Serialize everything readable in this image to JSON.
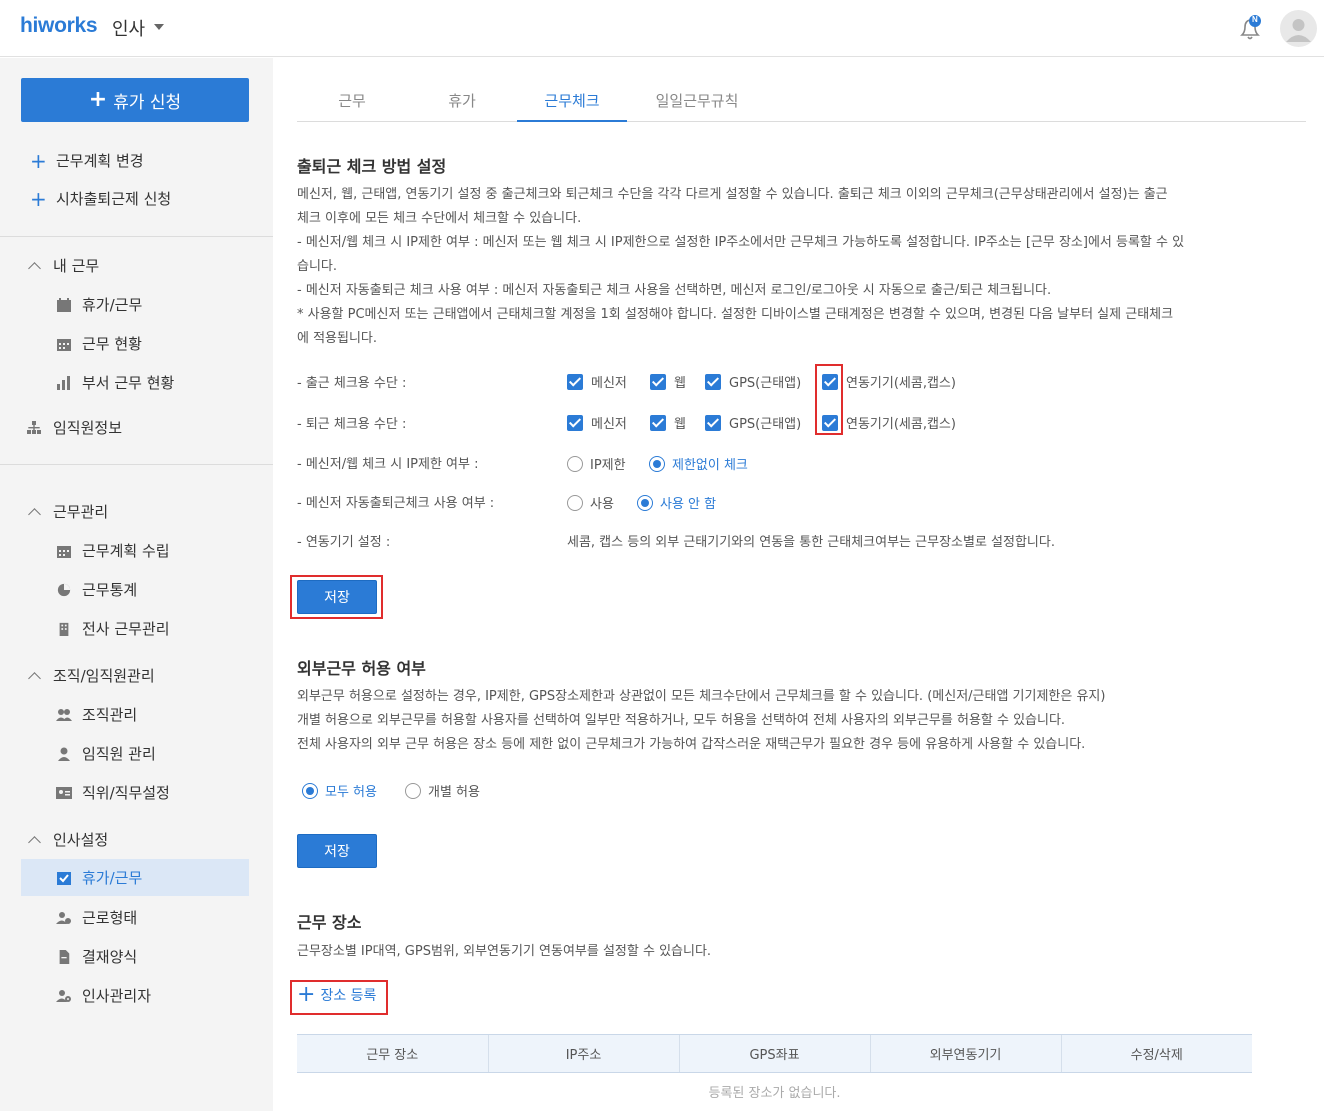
{
  "header": {
    "logo": "hiworks",
    "app_name": "인사",
    "notification_badge": "N",
    "icons": {
      "bell": "bell-icon",
      "avatar": "user-avatar-icon"
    }
  },
  "sidebar": {
    "apply_button": "휴가 신청",
    "links": [
      "근무계획 변경",
      "시차출퇴근제 신청"
    ],
    "my_work": {
      "title": "내 근무",
      "items": [
        "휴가/근무",
        "근무 현황",
        "부서 근무 현황"
      ]
    },
    "org_info": "임직원정보",
    "work_manage": {
      "title": "근무관리",
      "items": [
        "근무계획 수립",
        "근무통계",
        "전사 근무관리"
      ]
    },
    "org_manage": {
      "title": "조직/임직원관리",
      "items": [
        "조직관리",
        "임직원 관리",
        "직위/직무설정"
      ]
    },
    "hr_settings": {
      "title": "인사설정",
      "items": [
        "휴가/근무",
        "근로형태",
        "결재양식",
        "인사관리자"
      ],
      "active": "휴가/근무"
    }
  },
  "tabs": [
    "근무",
    "휴가",
    "근무체크",
    "일일근무규칙"
  ],
  "active_tab": "근무체크",
  "checkin": {
    "title": "출퇴근 체크 방법 설정",
    "desc": [
      "메신저, 웹, 근태앱, 연동기기 설정 중 출근체크와 퇴근체크 수단을 각각 다르게 설정할 수 있습니다. 출퇴근 체크 이외의 근무체크(근무상태관리에서 설정)는 출근",
      "체크 이후에 모든 체크 수단에서 체크할 수 있습니다.",
      "- 메신저/웹 체크 시 IP제한 여부 : 메신저 또는 웹 체크 시 IP제한으로 설정한 IP주소에서만 근무체크 가능하도록 설정합니다. IP주소는 [근무 장소]에서 등록할 수 있",
      "습니다.",
      "- 메신저 자동출퇴근 체크 사용 여부 : 메신저 자동출퇴근 체크 사용을 선택하면, 메신저 로그인/로그아웃 시 자동으로 출근/퇴근 체크됩니다.",
      "* 사용할 PC메신저 또는 근태앱에서 근태체크할 계정을 1회 설정해야 합니다. 설정한 디바이스별 근태계정은 변경할 수 있으며, 변경된 다음 날부터 실제 근태체크",
      "에 적용됩니다."
    ],
    "in_label": "- 출근 체크용 수단 :",
    "out_label": "- 퇴근 체크용 수단 :",
    "methods": [
      "메신저",
      "웹",
      "GPS(근태앱)",
      "연동기기(세콤,캡스)"
    ],
    "ip_label": "- 메신저/웹 체크 시 IP제한 여부 :",
    "ip_options": [
      "IP제한",
      "제한없이 체크"
    ],
    "ip_selected": "제한없이 체크",
    "auto_label": "- 메신저 자동출퇴근체크 사용 여부 :",
    "auto_options": [
      "사용",
      "사용 안 함"
    ],
    "auto_selected": "사용 안 함",
    "device_label": "- 연동기기 설정 :",
    "device_text": "세콤, 캡스 등의 외부 근태기기와의 연동을 통한 근태체크여부는 근무장소별로 설정합니다.",
    "save": "저장"
  },
  "external": {
    "title": "외부근무 허용 여부",
    "desc": [
      "외부근무 허용으로 설정하는 경우, IP제한, GPS장소제한과 상관없이 모든 체크수단에서 근무체크를 할 수 있습니다. (메신저/근태앱 기기제한은 유지)",
      "개별 허용으로 외부근무를 허용할 사용자를 선택하여 일부만 적용하거나, 모두 허용을 선택하여 전체 사용자의 외부근무를 허용할 수 있습니다.",
      "전체 사용자의 외부 근무 허용은 장소 등에 제한 없이 근무체크가 가능하여 갑작스러운 재택근무가 필요한 경우 등에 유용하게 사용할 수 있습니다."
    ],
    "options": [
      "모두 허용",
      "개별 허용"
    ],
    "selected": "모두 허용",
    "save": "저장"
  },
  "place": {
    "title": "근무 장소",
    "desc": "근무장소별 IP대역, GPS범위, 외부연동기기 연동여부를 설정할 수 있습니다.",
    "add": "장소 등록",
    "columns": [
      "근무 장소",
      "IP주소",
      "GPS좌표",
      "외부연동기기",
      "수정/삭제"
    ],
    "empty": "등록된 장소가 없습니다."
  },
  "colors": {
    "accent": "#2b7bd6",
    "highlight": "#e02d2d",
    "sidebar_bg": "#f4f4f4"
  }
}
